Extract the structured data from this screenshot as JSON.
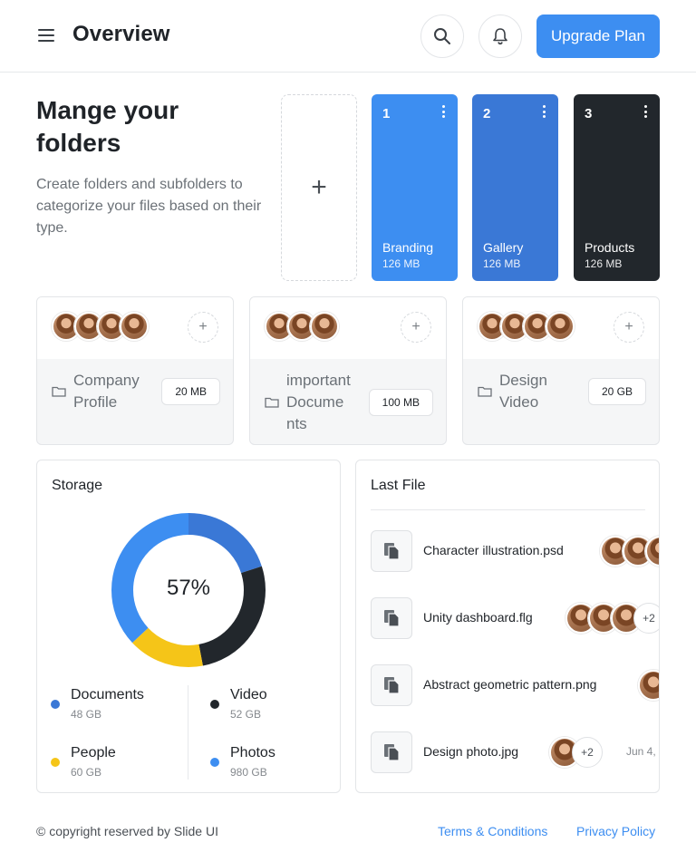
{
  "header": {
    "title": "Overview",
    "upgrade_label": "Upgrade Plan",
    "icons": [
      "menu-icon",
      "search-icon",
      "bell-icon"
    ]
  },
  "intro": {
    "title": "Mange your folders",
    "description": "Create folders and subfolders to categorize your files based on their type.",
    "add_symbol": "+"
  },
  "folders": [
    {
      "number": "1",
      "name": "Branding",
      "size": "126 MB",
      "color": "#3d8ef1"
    },
    {
      "number": "2",
      "name": "Gallery",
      "size": "126 MB",
      "color": "#3a78d6"
    },
    {
      "number": "3",
      "name": "Products",
      "size": "126 MB",
      "color": "#22272c"
    }
  ],
  "projects": [
    {
      "name_lines": [
        "Company",
        "Profile"
      ],
      "size": "20 MB",
      "avatars": 4,
      "add_symbol": "+"
    },
    {
      "name_lines": [
        "important",
        "Docume",
        "nts"
      ],
      "size": "100 MB",
      "avatars": 3,
      "add_symbol": "+"
    },
    {
      "name_lines": [
        "Design",
        "Video"
      ],
      "size": "20 GB",
      "avatars": 4,
      "add_symbol": "+"
    }
  ],
  "storage": {
    "title": "Storage",
    "percent_label": "57%",
    "legend": [
      {
        "label": "Documents",
        "value": "48 GB",
        "color": "#3a78d6"
      },
      {
        "label": "Video",
        "value": "52 GB",
        "color": "#22272c"
      },
      {
        "label": "People",
        "value": "60 GB",
        "color": "#f5c518"
      },
      {
        "label": "Photos",
        "value": "980 GB",
        "color": "#3d8ef1"
      }
    ]
  },
  "last_file": {
    "title": "Last File",
    "files": [
      {
        "name": "Character illustration.psd",
        "avatars": 3,
        "more": "",
        "date": ""
      },
      {
        "name": "Unity dashboard.flg",
        "avatars": 3,
        "more": "+2",
        "date": ""
      },
      {
        "name": "Abstract geometric pattern.png",
        "avatars": 1,
        "more": "",
        "date": ""
      },
      {
        "name": "Design photo.jpg",
        "avatars": 1,
        "more": "+2",
        "date": "Jun 4,"
      }
    ]
  },
  "footer": {
    "copyright": "© copyright reserved by Slide UI",
    "terms": "Terms & Conditions",
    "privacy": "Privacy Policy"
  }
}
